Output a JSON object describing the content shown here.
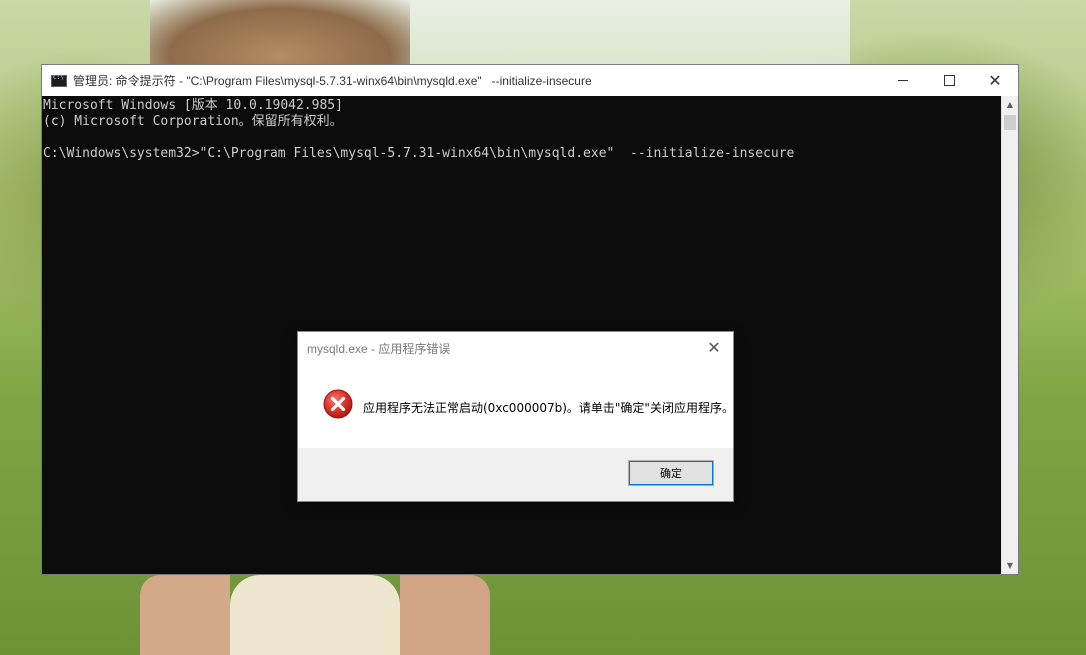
{
  "console_window": {
    "title": "管理员: 命令提示符 - \"C:\\Program Files\\mysql-5.7.31-winx64\\bin\\mysqld.exe\"   --initialize-insecure",
    "icon": "cmd-icon",
    "controls": {
      "minimize": "minimize-icon",
      "maximize": "maximize-icon",
      "close": "close-icon"
    },
    "lines": [
      "Microsoft Windows [版本 10.0.19042.985]",
      "(c) Microsoft Corporation。保留所有权利。",
      "",
      "C:\\Windows\\system32>\"C:\\Program Files\\mysql-5.7.31-winx64\\bin\\mysqld.exe\"  --initialize-insecure"
    ],
    "colors": {
      "background": "#0c0c0c",
      "text": "#cccccc"
    }
  },
  "dialog": {
    "title": "mysqld.exe - 应用程序错误",
    "message": "应用程序无法正常启动(0xc000007b)。请单击\"确定\"关闭应用程序。",
    "ok_label": "确定",
    "icon": "error-icon",
    "colors": {
      "error_red": "#d32f2f"
    }
  }
}
